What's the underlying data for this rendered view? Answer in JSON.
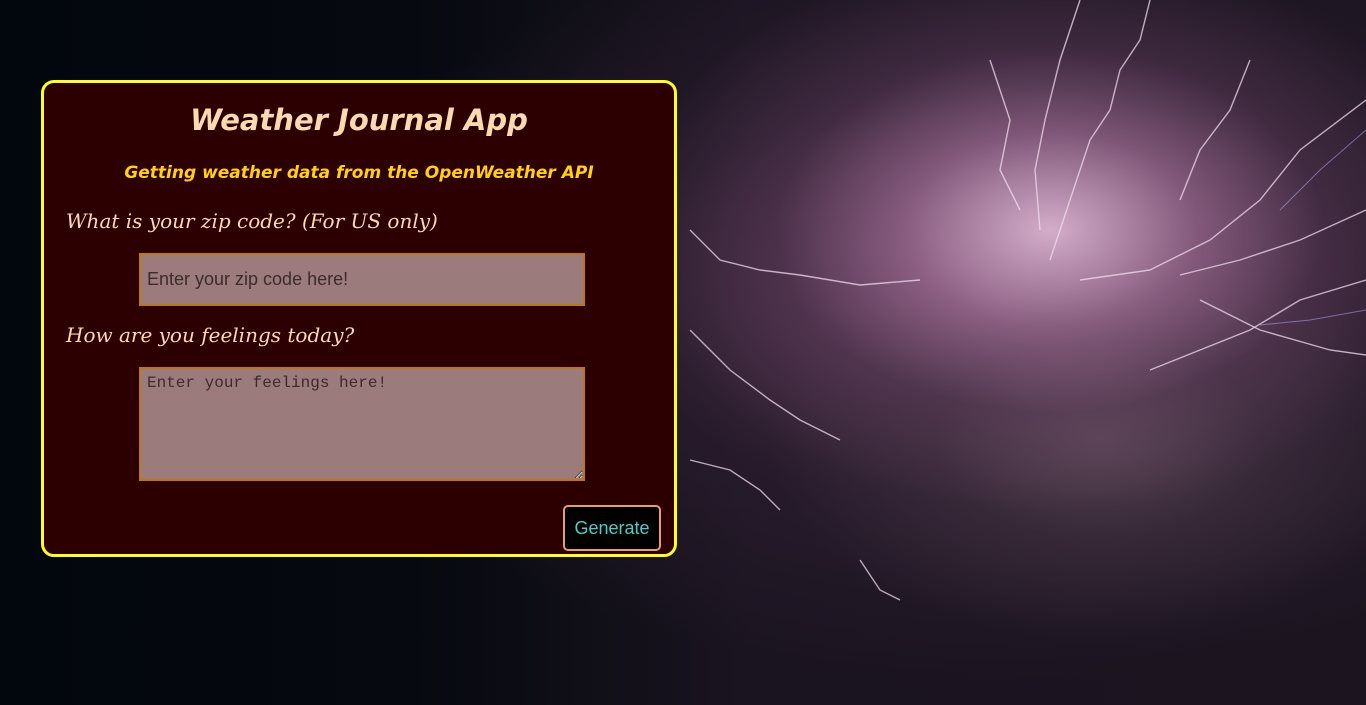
{
  "app": {
    "title": "Weather Journal App",
    "subtitle": "Getting weather data from the OpenWeather API"
  },
  "form": {
    "zip_label": "What is your zip code? (For US only)",
    "zip_placeholder": "Enter your zip code here!",
    "zip_value": "",
    "feelings_label": "How are you feelings today?",
    "feelings_placeholder": "Enter your feelings here!",
    "feelings_value": "",
    "generate_label": "Generate"
  },
  "colors": {
    "card_background": "#2d0000",
    "card_border": "#ffff1a",
    "title_color": "#fbd9b1",
    "subtitle_color": "#ffd20d",
    "input_background": "#9b7b7c",
    "input_border": "#b97a16",
    "button_text": "#4ecdc4",
    "button_border": "#e5a25d"
  },
  "background": {
    "icon": "lightning-storm-image"
  }
}
